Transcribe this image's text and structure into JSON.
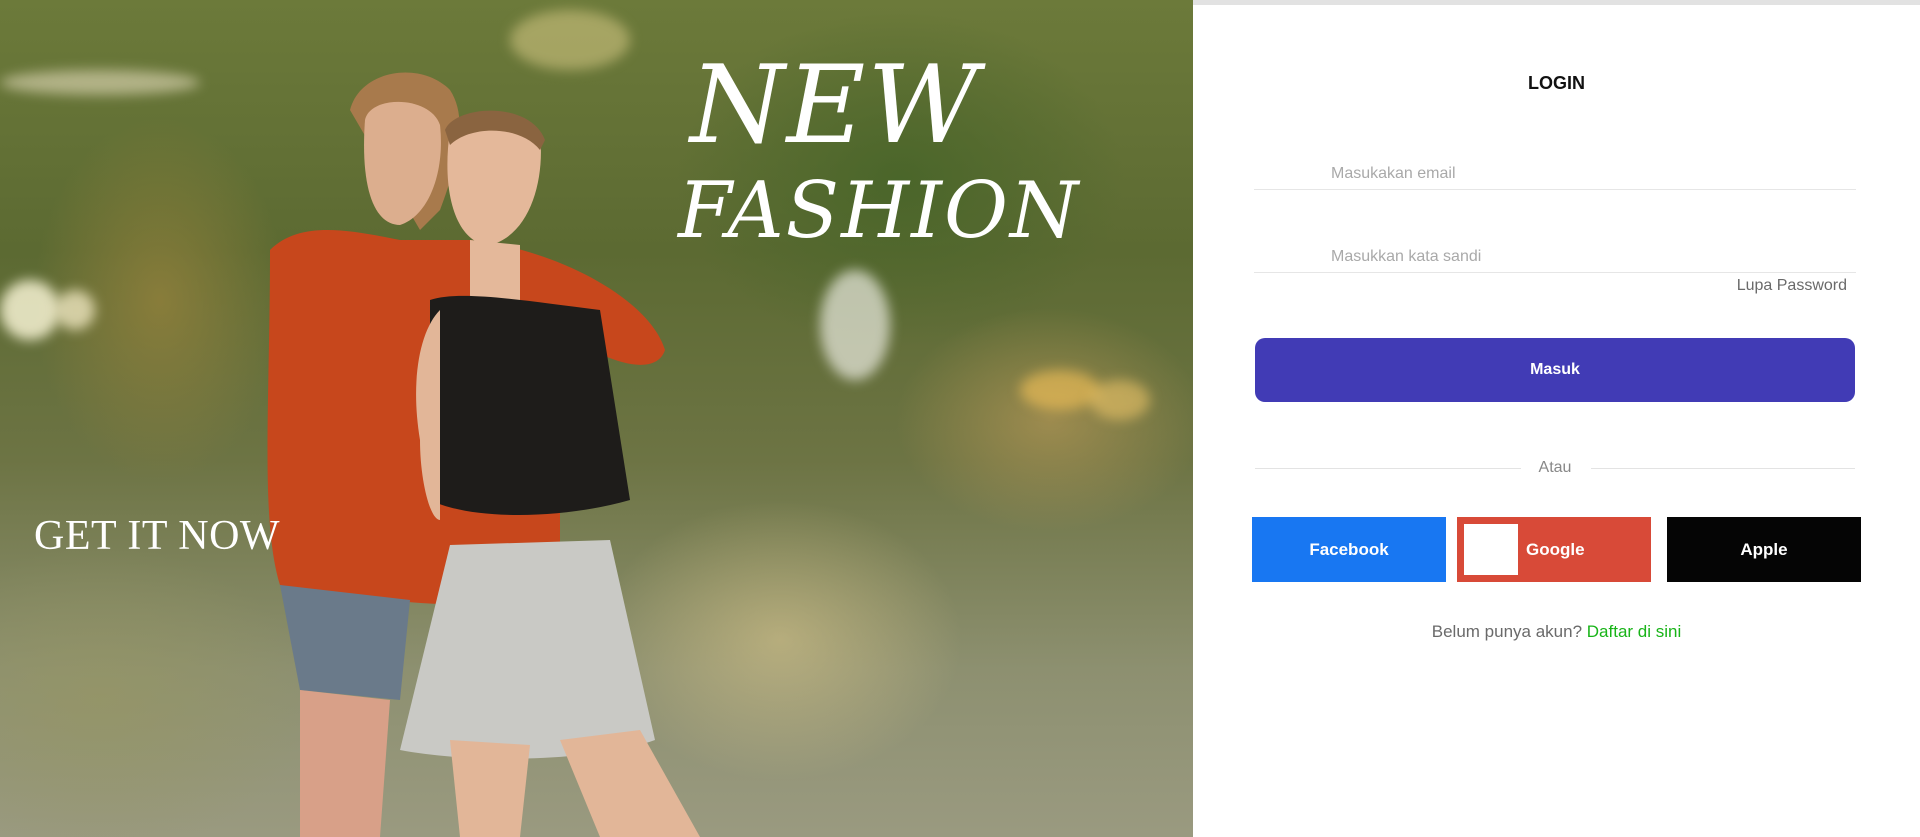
{
  "hero": {
    "title_line1": "NEW",
    "title_line2": "FASHION",
    "cta": "GET IT NOW"
  },
  "login": {
    "title": "LOGIN",
    "email_placeholder": "Masukakan email",
    "password_placeholder": "Masukkan kata sandi",
    "forgot_password": "Lupa Password",
    "submit_label": "Masuk",
    "divider_text": "Atau",
    "social": {
      "facebook": "Facebook",
      "google": "Google",
      "apple": "Apple"
    },
    "signup_prompt": "Belum punya akun?",
    "signup_link": "Daftar di sini"
  },
  "colors": {
    "primary": "#413bb5",
    "facebook": "#1877f2",
    "google": "#d84a38",
    "apple": "#050505",
    "link": "#18b418"
  }
}
